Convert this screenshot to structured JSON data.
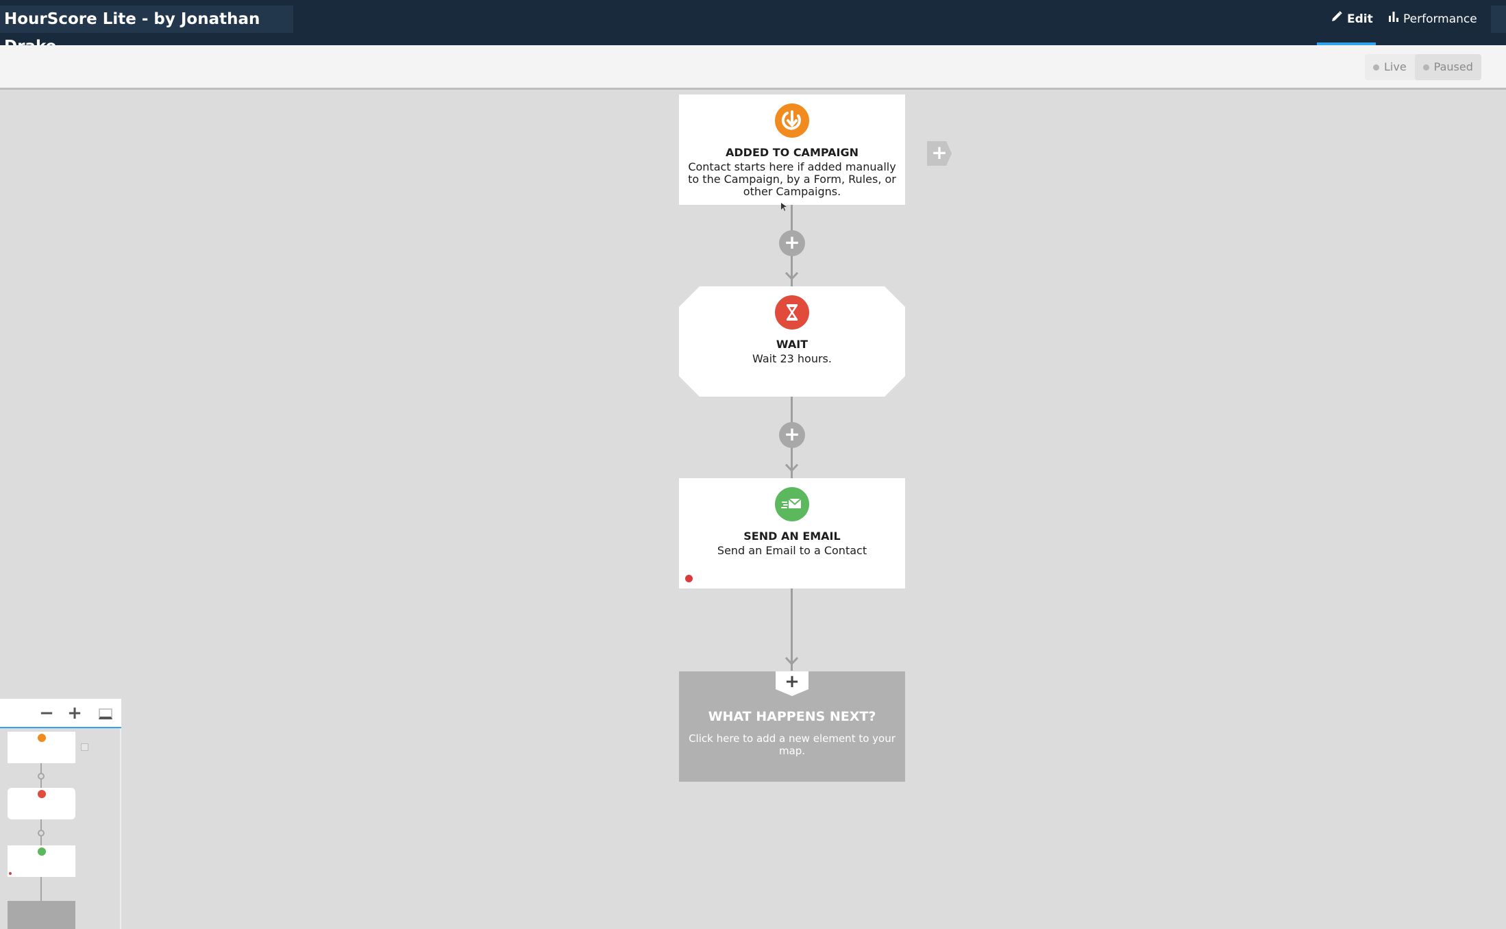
{
  "header": {
    "title": "HourScore Lite - by Jonathan Drake",
    "tabs": [
      {
        "label": "Edit",
        "icon": "pencil-icon",
        "active": true
      },
      {
        "label": "Performance",
        "icon": "bar-chart-icon",
        "active": false
      }
    ]
  },
  "status_toggle": {
    "options": [
      {
        "label": "Live",
        "active": false
      },
      {
        "label": "Paused",
        "active": true
      }
    ]
  },
  "flow": {
    "nodes": [
      {
        "id": "added-to-campaign",
        "title": "ADDED TO CAMPAIGN",
        "description": "Contact starts here if added manually to the Campaign, by a Form, Rules, or other Campaigns.",
        "icon": "entry-arrow-icon",
        "color": "#f28b1e"
      },
      {
        "id": "wait",
        "title": "WAIT",
        "description": "Wait 23 hours.",
        "icon": "hourglass-icon",
        "color": "#e14b3b"
      },
      {
        "id": "send-email",
        "title": "SEND AN EMAIL",
        "description": "Send an Email to a Contact",
        "icon": "email-send-icon",
        "color": "#5cb85c",
        "has_error": true
      }
    ],
    "next": {
      "title": "WHAT HAPPENS NEXT?",
      "description": "Click here to add a new element to your map."
    }
  },
  "minimap": {
    "controls": [
      "zoom-out",
      "zoom-in",
      "fit-to-screen"
    ]
  },
  "colors": {
    "topbar": "#182a3c",
    "accent": "#2ea3f2",
    "canvas": "#dcdcdc"
  }
}
